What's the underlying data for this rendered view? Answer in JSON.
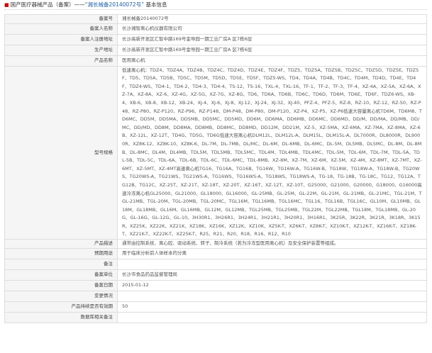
{
  "header": {
    "prefix": "国产医疗器械产品（备案）——",
    "highlight": "“湘长械备20140072号”",
    "suffix": " 基本信息"
  },
  "rows": [
    {
      "label": "备案号",
      "value": "湘长械备20140072号"
    },
    {
      "label": "备案人名称",
      "value": "长沙湘智离心机仪器有限公司"
    },
    {
      "label": "备案人注册地址",
      "value": "长沙高新开发区汇智中路169号金导园一期工业厂房A 区7栋6层"
    },
    {
      "label": "生产地址",
      "value": "长沙高新开发区汇智中路169号金导园一期工业厂房A 区7栋6层"
    },
    {
      "label": "产品名称",
      "value": "医用离心机"
    },
    {
      "label": "型号规格",
      "value": "低速离心机：TDZ4、TDZ4A、TDZ4B、TDZ4C、TDZ4D、TDZ4E、TDZ4F、TDZ5、TDZ5A、TDZ5B、TDZ5C、TDZ5D、TDZ5E、TDZ5F、TD5、TD5A、TD5B、TD5C、TD5M、TD5D、TD5E、TD5F、TDZ5-WS、TD4、TD4A、TD4B、TD4C、TD4M、TD4D、TD4E、TD4F、TDZ4-WS、TD4-1、TD4-2、TD4-3、TD4-4、TS-12、TS-16、TXL-4、TXL-16、TF-1、TF-2、TF-3、TF-4、XZ-4A、XZ-5A、XZ-6A、XZ-7A、XZ-8A、XZ-6、XZ-4G、XZ-5G、XZ-7G、XZ-8G、TD6、TD6A、TD6B、TD6C、TD6D、TD6M、TD6E、TD6F、TDZ6-WS、XB-4、XB-6、XB-8、XB-12、XB-24、XJ-4、XJ-6、XJ-8、XJ-12、XJ-24、XJ-32、XJ-40、PFZ-4、PFZ-5、RZ-8、RZ-10、RZ-12、RZ-50、RZ-P48、RZ-P80、RZ-P120、RZ-P96、RZ-P148、DM-P48、DM-P80、DM-P120、XZ-P4、XZ-P5、XZ-P6低速大容量离心机TD6M、TD6M8、TD6MC、DD5M、DD5MA、DD5MB、DD5MC、DD5MD、DD6M、DD6MA、DD6MB、DD6MC、DD6MD、DD/M、DD/MA、DD/MB、DD/MC、DD/MD、DD8M、DD8MA、DD8MB、DD8MC、DD8MD、DD12M、DD21M、XZ-5、XZ-5MA、XZ-6MA、XZ-7MA、XZ-8MA、XZ-6B、XZ-12L、XZ-12T、TD4G、TD5G、TD6G低速大容离心机DLM12L、DLM12L-A、DLM15L、DLM15L-A、DL7000R、DL8000R、DL9000R、XZ8K-12、XZ8K-10、XZ8K-6、DL-7M、DL-7MB、DL/MC、DL-6M、DL-6MB、DL-6MC、DL-5M、DL5MB、DL5MC、DL-8M、DL-8MB、DL-8MC、DL4M、DL4MB、TDL5M、TDL5MB、TDL5MC、TDL4M、TDL4MB、TDL4MC、TDL-5M、TDL-6M、TDL-7M、TDL-5A、TDL-5B、TDL-5C、TDL-6A、TDL-6B、TDL-6C、TDL-6MC、TDL-8MB、XZ-8M、XZ-7M、XZ-6M、XZ-5M、XZ-4M、XZ-8MT、XZ-7MT、XZ-6MT、XZ-5MT、XZ-4MT高速离心机TG16、TG16A、TG16B、TG16W、TG16W-A、TG16W-B、TG18W、TG18W-A、TG18W-B、TG20WS、TG20WS-A、TG21WS、TG21WS-A、TG16WS、TG16WS-A、TG18WS、TG18WS-A、TG-18、TG-18B、TG-18C、TG12、TG12A、TG12B、TG12C、XZ-25T、XZ-21T、XZ-18T、XZ-20T、XZ-16T、XZ-12T、XZ-10T、G25000、G21000、G20000、G18000、G16000高速冷冻离心机GL25000、GL21000、GL18000、GL16000、GL-25MB、GL-25M、GL-22M、GL-21M、GL-21MB、GL-21MC、TGL-21M、TGL-21MB、TGL-20M、TGL-20MB、TGL-20MC、TGL16M、TGL16MB、TGL16MC、TGL16、TGL16B、TGL16C、GL10M、GL10MB、GL18M、GL18MB、GL16M、GL16MB、GL12M、GL12MB、TGL25MB、TGL25MB、TGL22M、TGL22MB、TGL18M、TGL18MB、GL-20G、GL-16G、GL-12G、GL-10、3H30R1、3H26R1、3H24R1、3H21R1、3H20R1、3H16R1、3K25R、3K22R、3K21R、3K18R、3K15R、XZ25K、XZ22K、XZ21K、XZ18K、XZ16K、XZ12K、XZ10K、XZ5K-T、XZ6K-T、XZ8K-T、XZ10K-T、XZ12K-T、XZ16K-T、XZ18K-T、XZ21K-T、XZ22K-T、XZ25K-T、R25、R21、R20、R18、R16、R12、R10"
    },
    {
      "label": "产品描述",
      "value": "通常由控制系统、离心腔、驱动系统、转子、制冷系统（若为冷冻型医用离心机）及安全保护装置等组成。"
    },
    {
      "label": "预期用途",
      "value": "用于临床分析前人体样本的分离"
    },
    {
      "label": "备注",
      "value": ""
    },
    {
      "label": "备案单位",
      "value": "长沙市食品药品监督管理局"
    },
    {
      "label": "备案日期",
      "value": "2015-01-12"
    },
    {
      "label": "变更情况",
      "value": ""
    },
    {
      "label": "产品持续是否有效期",
      "value": "50"
    },
    {
      "label": "数据库相关备注",
      "value": ""
    }
  ]
}
